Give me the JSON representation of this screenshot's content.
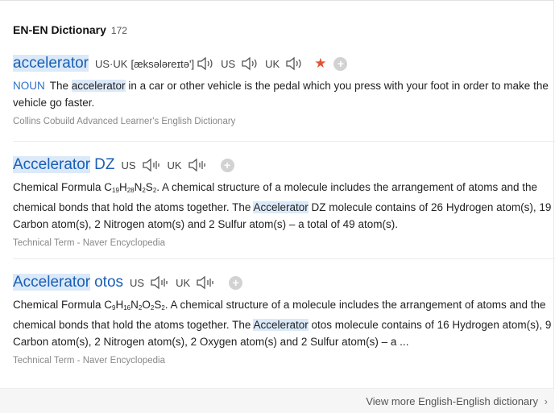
{
  "header": {
    "title": "EN-EN Dictionary",
    "count": "172"
  },
  "entries": [
    {
      "word": "accelerator",
      "suffix": "",
      "pron_label": "US·UK",
      "ipa": "[æksələreɪtə']",
      "audio": [
        "US",
        "UK"
      ],
      "pos": "NOUN",
      "def_parts": [
        "The ",
        "accelerator",
        " in a car or other vehicle is the pedal which you press with your foot in order to make the vehicle go faster."
      ],
      "source": "Collins Cobuild Advanced Learner's English Dictionary"
    },
    {
      "word": "Accelerator",
      "suffix": "DZ",
      "audio": [
        "US",
        "UK"
      ],
      "def_a": "Chemical Formula C",
      "formula": [
        "19",
        "H",
        "28",
        "N",
        "2",
        "S",
        "2"
      ],
      "def_b": ". A chemical structure of a molecule includes the arrangement of atoms and the chemical bonds that hold the atoms together. The ",
      "def_hl": "Accelerator",
      "def_c": " DZ molecule contains of 26 Hydrogen atom(s), 19 Carbon atom(s), 2 Nitrogen atom(s) and 2 Sulfur atom(s) – a total of 49 atom(s).",
      "source": "Technical Term - Naver Encyclopedia"
    },
    {
      "word": "Accelerator",
      "suffix": "otos",
      "audio": [
        "US",
        "UK"
      ],
      "def_a": "Chemical Formula C",
      "formula": [
        "9",
        "H",
        "16",
        "N",
        "2",
        "O",
        "2",
        "S",
        "2"
      ],
      "def_b": ". A chemical structure of a molecule includes the arrangement of atoms and the chemical bonds that hold the atoms together. The ",
      "def_hl": "Accelerator",
      "def_c": " otos molecule contains of 16 Hydrogen atom(s), 9 Carbon atom(s), 2 Nitrogen atom(s), 2 Oxygen atom(s) and 2 Sulfur atom(s) – a ...",
      "source": "Technical Term - Naver Encyclopedia"
    }
  ],
  "footer": {
    "more_label": "View more English-English dictionary"
  },
  "icons": {
    "speaker": "speaker-icon",
    "star": "star-icon",
    "add": "plus-icon",
    "chevron": "chevron-right-icon"
  },
  "colors": {
    "link": "#1a5fb4",
    "highlight": "#dbe9f9",
    "star": "#e0533b"
  }
}
